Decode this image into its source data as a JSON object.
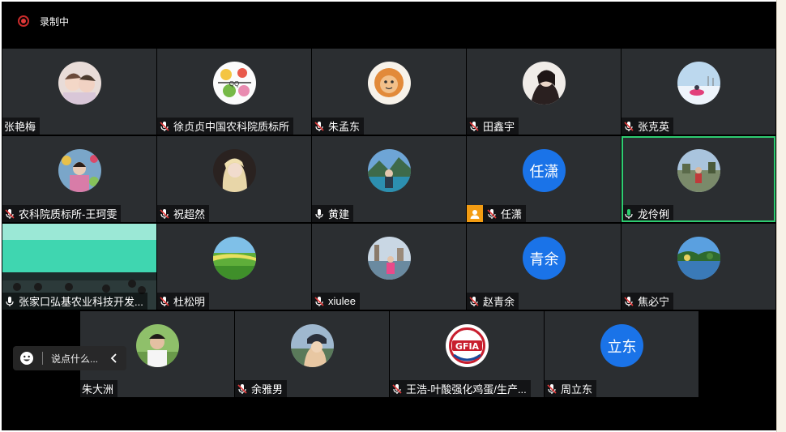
{
  "recording": {
    "label": "录制中"
  },
  "participants": [
    {
      "name": "张艳梅"
    },
    {
      "name": "徐贞贞中国农科院质标所"
    },
    {
      "name": "朱孟东"
    },
    {
      "name": "田鑫宇"
    },
    {
      "name": "张克英"
    },
    {
      "name": "农科院质标所-王珂雯"
    },
    {
      "name": "祝超然"
    },
    {
      "name": "黄建"
    },
    {
      "name": "任潇",
      "avatar_text": "任潇"
    },
    {
      "name": "龙伶俐"
    },
    {
      "name": "张家口弘基农业科技开发..."
    },
    {
      "name": "杜松明"
    },
    {
      "name": "xiulee"
    },
    {
      "name": "赵青余",
      "avatar_text": "青余"
    },
    {
      "name": "焦必宁"
    },
    {
      "name": "朱大洲"
    },
    {
      "name": "余雅男"
    },
    {
      "name": "王浩-叶酸强化鸡蛋/生产..."
    },
    {
      "name": "周立东",
      "avatar_text": "立东"
    }
  ],
  "logo": {
    "text": "GFIA"
  },
  "chat": {
    "placeholder": "说点什么..."
  },
  "colors": {
    "active_speaker_border": "#2ecc71",
    "avatar_blue": "#1a73e8",
    "recording_red": "#e03a3a"
  }
}
